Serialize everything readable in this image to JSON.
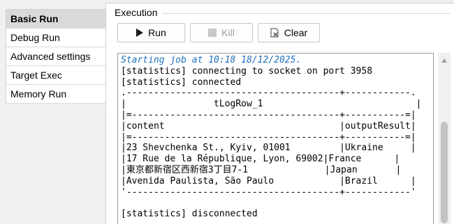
{
  "sidebar": {
    "items": [
      {
        "label": "Basic Run",
        "active": true
      },
      {
        "label": "Debug Run",
        "active": false
      },
      {
        "label": "Advanced settings",
        "active": false
      },
      {
        "label": "Target Exec",
        "active": false
      },
      {
        "label": "Memory Run",
        "active": false
      }
    ]
  },
  "execution": {
    "section_title": "Execution",
    "buttons": {
      "run": "Run",
      "kill": "Kill",
      "clear": "Clear"
    }
  },
  "console": {
    "lines": [
      "Starting job at 10:18 18/12/2025.",
      "[statistics] connecting to socket on port 3958",
      "[statistics] connected",
      ".---------------------------------------+------------.",
      "|                tLogRow_1                            |",
      "|=--------------------------------------+-----------=|",
      "|content                                |outputResult|",
      "|=--------------------------------------+-----------=|",
      "|23 Shevchenka St., Kyiv, 01001         |Ukraine     |",
      "|17 Rue de la République, Lyon, 69002|France      |",
      "|東京都新宿区西新宿3丁目7-1              |Japan       |",
      "|Avenida Paulista, São Paulo            |Brazil      |",
      "'---------------------------------------+------------'",
      "",
      "[statistics] disconnected"
    ]
  },
  "colors": {
    "accent_text": "#1f6fbf",
    "sidebar_active_bg": "#d9d9d9",
    "disabled_text": "#a0a0a0"
  },
  "icons": {
    "run": "play-triangle-icon",
    "kill": "stop-square-icon",
    "clear": "clear-console-icon"
  }
}
